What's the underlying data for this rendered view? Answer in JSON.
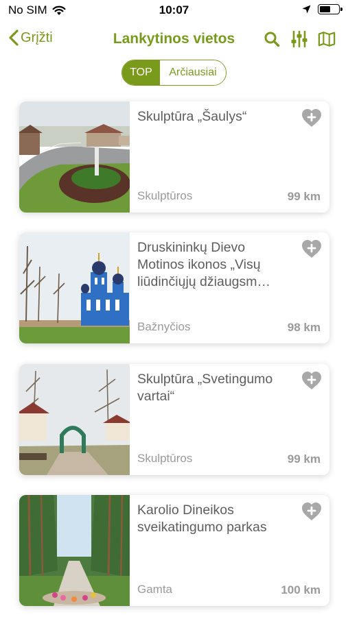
{
  "status_bar": {
    "carrier": "No SIM",
    "time": "10:07",
    "battery_level": 0.6
  },
  "nav": {
    "back_label": "Grįžti",
    "title": "Lankytinos vietos",
    "icons": [
      "search-icon",
      "filter-icon",
      "map-icon"
    ]
  },
  "segments": {
    "top_label": "TOP",
    "nearest_label": "Arčiausiai",
    "selected": "TOP"
  },
  "colors": {
    "accent": "#7a9a1c",
    "heart": "#a8a8a8"
  },
  "places": [
    {
      "title": "Skulptūra „Šaulys“",
      "category": "Skulptūros",
      "distance": "99 km",
      "image": "street-roundabout-sculpture"
    },
    {
      "title": "Druskininkų Dievo Motinos ikonos „Visų liūdinčiųjų džiaugsm…",
      "category": "Bažnyčios",
      "distance": "98 km",
      "image": "blue-orthodox-church"
    },
    {
      "title": "Skulptūra „Svetingumo vartai“",
      "category": "Skulptūros",
      "distance": "99 km",
      "image": "horseshoe-arch-sculpture"
    },
    {
      "title": "Karolio Dineikos sveikatingumo parkas",
      "category": "Gamta",
      "distance": "100 km",
      "image": "pine-park-alley"
    }
  ]
}
